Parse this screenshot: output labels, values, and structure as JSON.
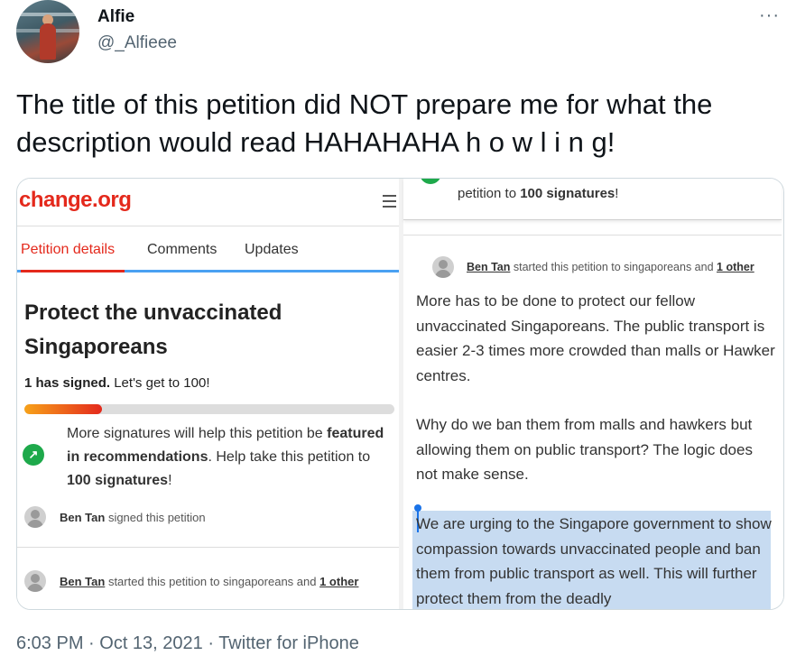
{
  "author": {
    "name": "Alfie",
    "handle": "@_Alfieee"
  },
  "more_label": "···",
  "tweet_text": "The title of this petition did NOT prepare me for what the description would read HAHAHAHA h o w l i n g!",
  "media": {
    "left": {
      "logo": "change.org",
      "tabs": [
        "Petition details",
        "Comments",
        "Updates"
      ],
      "petition_title": "Protect the unvaccinated Singaporeans",
      "signed_count": "1 has signed.",
      "signed_goal": " Let's get to 100!",
      "progress": 0.21,
      "feature_line1": "More signatures will help this petition be",
      "feature_bold1": "featured in recommendations",
      "feature_line2": ". Help take this petition to ",
      "feature_bold2": "100 signatures",
      "feature_end": "!",
      "activity1_name": "Ben Tan",
      "activity1_text": " signed this petition",
      "activity2_name": "Ben Tan",
      "activity2_text": " started this petition to singaporeans and ",
      "activity2_link": "1 other"
    },
    "right": {
      "sig_text": "petition to ",
      "sig_bold": "100 signatures",
      "sig_end": "!",
      "starter_name": "Ben Tan",
      "starter_text": " started this petition to singaporeans and ",
      "starter_link": "1 other",
      "para1": "More has to be done to protect our fellow unvaccinated Singaporeans. The public transport is easier 2-3 times more crowded than malls or Hawker centres.",
      "para2": "Why do we ban them from malls and hawkers but allowing them on public transport? The logic does not make sense.",
      "para3": "We are urging to the Singapore government to show compassion towards unvaccinated people and ban them from public transport as well. This will further protect them from the deadly"
    }
  },
  "footer": "6:03 PM · Oct 13, 2021 · Twitter for iPhone",
  "colors": {
    "change_red": "#e4291c",
    "tab_blue": "#4aa1f2",
    "feature_green": "#1ea94b",
    "highlight": "#c7dbf1"
  }
}
